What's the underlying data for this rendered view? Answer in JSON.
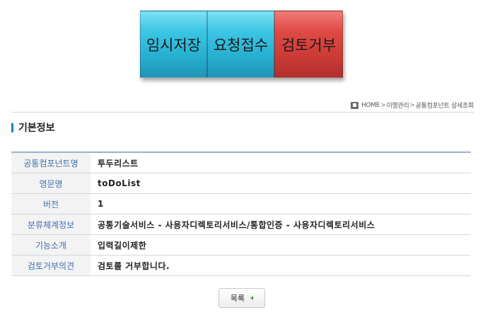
{
  "actions": {
    "temp_save": "임시저장",
    "request_receive": "요청접수",
    "review_reject": "검토거부"
  },
  "breadcrumb": {
    "home": "HOME",
    "sep": ">",
    "level1": "이행관리",
    "level2": "공통컴포넌트 상세조회"
  },
  "section": {
    "title": "기본정보"
  },
  "rows": [
    {
      "label": "공통컴포넌트명",
      "value": "투두리스트"
    },
    {
      "label": "영문명",
      "value": "toDoList"
    },
    {
      "label": "버전",
      "value": "1"
    },
    {
      "label": "분류체계정보",
      "value": "공통기술서비스 - 사용자디렉토리서비스/통합인증 - 사용자디렉토리서비스"
    },
    {
      "label": "기능소개",
      "value": "입력길이제한"
    },
    {
      "label": "검토거부의견",
      "value": "검토를 거부합니다."
    }
  ],
  "footer": {
    "list_label": "목록"
  },
  "colors": {
    "cyan": "#26aed0",
    "red": "#cc3a36",
    "accent": "#1e7fd0"
  }
}
